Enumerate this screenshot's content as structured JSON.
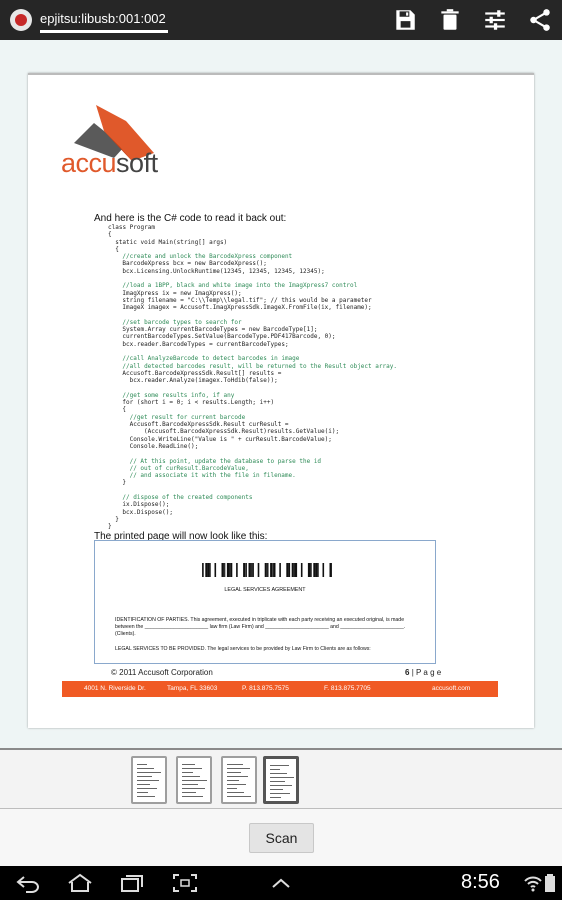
{
  "actionbar": {
    "title": "epjitsu:libusb:001:002",
    "icons": [
      "save-icon",
      "delete-icon",
      "settings-sliders-icon",
      "share-icon"
    ]
  },
  "document": {
    "brand_prefix": "accu",
    "brand_suffix": "soft",
    "intro_text": "And here is the C# code to read it back out:",
    "code_lines": [
      {
        "t": "class Program",
        "i": 0,
        "k": "plain"
      },
      {
        "t": "{",
        "i": 0,
        "k": "plain"
      },
      {
        "t": "static void Main(string[] args)",
        "i": 2,
        "k": "plain"
      },
      {
        "t": "{",
        "i": 2,
        "k": "plain"
      },
      {
        "t": "//create and unlock the BarcodeXpress component",
        "i": 4,
        "k": "comment"
      },
      {
        "t": "BarcodeXpress bcx = new BarcodeXpress();",
        "i": 4,
        "k": "plain"
      },
      {
        "t": "bcx.Licensing.UnlockRuntime(12345, 12345, 12345, 12345);",
        "i": 4,
        "k": "plain"
      },
      {
        "t": "",
        "i": 0,
        "k": "plain"
      },
      {
        "t": "//load a 1BPP, black and white image into the ImagXpress7 control",
        "i": 4,
        "k": "comment"
      },
      {
        "t": "ImagXpress ix = new ImagXpress();",
        "i": 4,
        "k": "plain"
      },
      {
        "t": "string filename = \"C:\\\\Temp\\\\legal.tif\"; // this would be a parameter",
        "i": 4,
        "k": "plain"
      },
      {
        "t": "ImageX imagex = Accusoft.ImagXpressSdk.ImageX.FromFile(ix, filename);",
        "i": 4,
        "k": "plain"
      },
      {
        "t": "",
        "i": 0,
        "k": "plain"
      },
      {
        "t": "//set barcode types to search for",
        "i": 4,
        "k": "comment"
      },
      {
        "t": "System.Array currentBarcodeTypes = new BarcodeType[1];",
        "i": 4,
        "k": "plain"
      },
      {
        "t": "currentBarcodeTypes.SetValue(BarcodeType.PDF417Barcode, 0);",
        "i": 4,
        "k": "plain"
      },
      {
        "t": "bcx.reader.BarcodeTypes = currentBarcodeTypes;",
        "i": 4,
        "k": "plain"
      },
      {
        "t": "",
        "i": 0,
        "k": "plain"
      },
      {
        "t": "//call AnalyzeBarcode to detect barcodes in image",
        "i": 4,
        "k": "comment"
      },
      {
        "t": "//all detected barcodes result, will be returned to the Result object array.",
        "i": 4,
        "k": "comment"
      },
      {
        "t": "Accusoft.BarcodeXpressSdk.Result[] results =",
        "i": 4,
        "k": "plain"
      },
      {
        "t": "bcx.reader.Analyze(imagex.ToHdib(false));",
        "i": 6,
        "k": "plain"
      },
      {
        "t": "",
        "i": 0,
        "k": "plain"
      },
      {
        "t": "//get some results info, if any",
        "i": 4,
        "k": "comment"
      },
      {
        "t": "for (short i = 0; i < results.Length; i++)",
        "i": 4,
        "k": "plain"
      },
      {
        "t": "{",
        "i": 4,
        "k": "plain"
      },
      {
        "t": "//get result for current barcode",
        "i": 6,
        "k": "comment"
      },
      {
        "t": "Accusoft.BarcodeXpressSdk.Result curResult =",
        "i": 6,
        "k": "plain"
      },
      {
        "t": "(Accusoft.BarcodeXpressSdk.Result)results.GetValue(i);",
        "i": 10,
        "k": "plain"
      },
      {
        "t": "Console.WriteLine(\"Value is \" + curResult.BarcodeValue);",
        "i": 6,
        "k": "plain"
      },
      {
        "t": "Console.ReadLine();",
        "i": 6,
        "k": "plain"
      },
      {
        "t": "",
        "i": 0,
        "k": "plain"
      },
      {
        "t": "// At this point, update the database to parse the id",
        "i": 6,
        "k": "comment"
      },
      {
        "t": "// out of curResult.BarcodeValue,",
        "i": 6,
        "k": "comment"
      },
      {
        "t": "// and associate it with the file in filename.",
        "i": 6,
        "k": "comment"
      },
      {
        "t": "}",
        "i": 4,
        "k": "plain"
      },
      {
        "t": "",
        "i": 0,
        "k": "plain"
      },
      {
        "t": "// dispose of the created components",
        "i": 4,
        "k": "comment"
      },
      {
        "t": "ix.Dispose();",
        "i": 4,
        "k": "plain"
      },
      {
        "t": "bcx.Dispose();",
        "i": 4,
        "k": "plain"
      },
      {
        "t": "}",
        "i": 2,
        "k": "plain"
      },
      {
        "t": "}",
        "i": 0,
        "k": "plain"
      }
    ],
    "printed_page_text": "The printed page will now look like this:",
    "inset_title": "LEGAL SERVICES AGREEMENT",
    "inset_para": "IDENTIFICATION OF PARTIES. This agreement, executed in triplicate with each party receiving an executed original, is made between the ______________________ law firm (Law Firm) and ______________________ and ______________________. (Clients).",
    "inset_para2": "LEGAL SERVICES TO BE PROVIDED. The legal services to be provided by Law Firm to Clients are as follows:",
    "copyright": "© 2011 Accusoft Corporation",
    "page_number": "6",
    "page_label": "| P a g e",
    "footer": {
      "address": "4001 N. Riverside Dr.",
      "city": "Tampa, FL 33603",
      "phone": "P. 813.875.7575",
      "fax": "F. 813.875.7705",
      "web": "accusoft.com"
    }
  },
  "thumbnails": [
    {
      "label": "page-1",
      "selected": false
    },
    {
      "label": "page-2",
      "selected": false
    },
    {
      "label": "page-3",
      "selected": false
    },
    {
      "label": "page-4",
      "selected": true
    }
  ],
  "scan_button": "Scan",
  "system_bar": {
    "time": "8:56",
    "icons": [
      "back-icon",
      "home-icon",
      "recent-apps-icon",
      "screenshot-icon",
      "chevron-up-icon",
      "wifi-icon",
      "battery-icon"
    ]
  },
  "colors": {
    "actionbar": "#262626",
    "brand_orange": "#e0592b",
    "footer_band": "#f05a24"
  }
}
